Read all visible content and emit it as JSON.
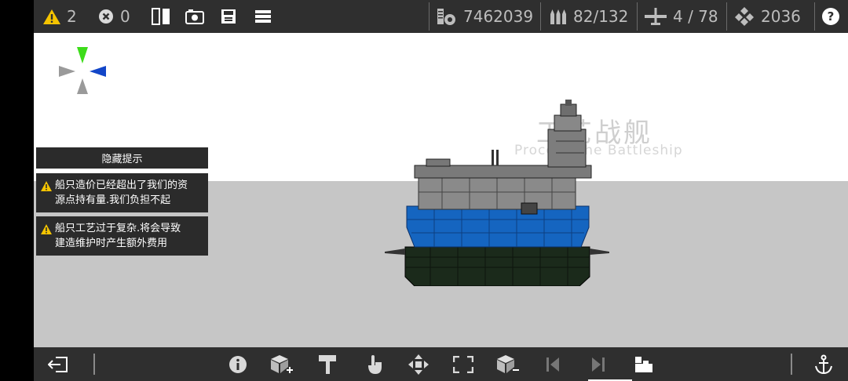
{
  "topbar": {
    "warnings": "2",
    "errors": "0",
    "cost": "7462039",
    "ammo": "82/132",
    "aircraft": "4 / 78",
    "weight": "2036",
    "help": "?"
  },
  "watermark": {
    "title_cn": "工艺战舰",
    "title_en": "Process The Battleship"
  },
  "hints": {
    "header": "隐藏提示",
    "items": [
      {
        "line1": "船只造价已经超出了我们的资",
        "line2": "源点持有量.我们负担不起"
      },
      {
        "line1": "船只工艺过于复杂.将会导致",
        "line2": "建造维护时产生额外费用"
      }
    ]
  },
  "colors": {
    "bar": "#2f2f2f",
    "warning": "#f5c400",
    "hull_blue": "#1565c0",
    "hull_dark": "#1b2a1b",
    "superstructure": "#7a7a7a",
    "compass_green": "#3ddc1a",
    "compass_blue": "#1246c8"
  },
  "icons": {
    "top": [
      "warning-icon",
      "error-icon",
      "mirror-icon",
      "camera-icon",
      "save-icon",
      "menu-icon",
      "cost-icon",
      "ammo-icon",
      "aircraft-icon",
      "weight-icon",
      "help-icon"
    ],
    "bottom": [
      "exit-icon",
      "info-icon",
      "add-part-icon",
      "paint-icon",
      "hand-icon",
      "move-icon",
      "scale-icon",
      "remove-part-icon",
      "prev-icon",
      "next-icon",
      "ship-parts-icon",
      "anchor-icon"
    ]
  }
}
